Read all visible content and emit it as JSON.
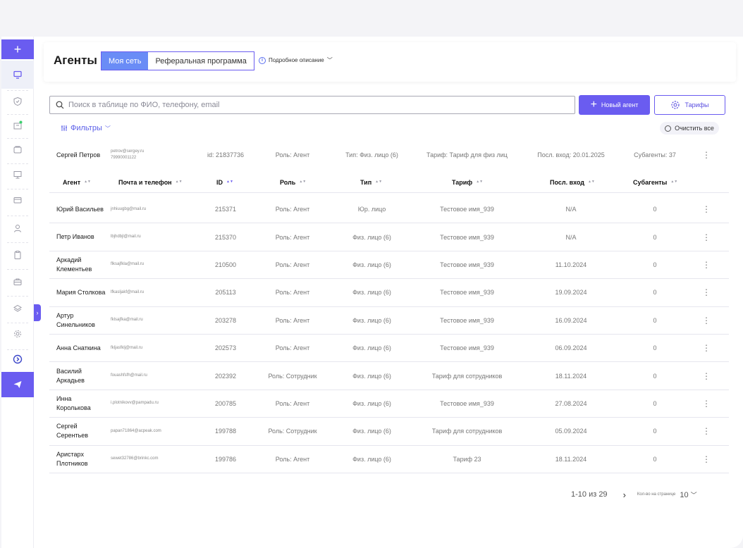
{
  "header": {
    "title": "Агенты",
    "tabs": [
      {
        "label": "Моя сеть",
        "active": true
      },
      {
        "label": "Реферальная программа",
        "active": false
      }
    ],
    "description_link": "Подробное описание"
  },
  "toolbar": {
    "search_placeholder": "Поиск в таблице по ФИО, телефону, email",
    "new_agent_label": "Новый агент",
    "tariffs_label": "Тарифы",
    "filters_label": "Фильтры",
    "clear_all_label": "Очистить все"
  },
  "summary": {
    "name": "Сергей Петров",
    "email": "petrov@sergey.ru",
    "phone": "79990001122",
    "id": "id: 21837736",
    "role": "Роль: Агент",
    "type": "Тип: Физ. лицо (6)",
    "tariff": "Тариф: Тариф для физ лиц",
    "last_login": "Посл. вход: 20.01.2025",
    "subagents": "Субагенты: 37"
  },
  "table": {
    "columns": [
      "Агент",
      "Почта и телефон",
      "ID",
      "Роль",
      "Тип",
      "Тариф",
      "Посл. вход",
      "Субагенты"
    ],
    "rows": [
      {
        "name": "Юрий Васильев",
        "email": "jnhiuugbg@mail.ru",
        "id": "215371",
        "role": "Роль: Агент",
        "type": "Юр. лицо",
        "tariff": "Тестовое имя_939",
        "last_login": "N/A",
        "subagents": "0"
      },
      {
        "name": "Петр Иванов",
        "email": "lbjhdbjl@mail.ru",
        "id": "215370",
        "role": "Роль: Агент",
        "type": "Физ. лицо (6)",
        "tariff": "Тестовое имя_939",
        "last_login": "N/A",
        "subagents": "0"
      },
      {
        "name": "Аркадий Клементьев",
        "email": "flksajfkla@mail.ru",
        "id": "210500",
        "role": "Роль: Агент",
        "type": "Физ. лицо (6)",
        "tariff": "Тестовое имя_939",
        "last_login": "11.10.2024",
        "subagents": "0"
      },
      {
        "name": "Мария Столкова",
        "email": "lfkasljakf@mail.ru",
        "id": "205113",
        "role": "Роль: Агент",
        "type": "Физ. лицо (6)",
        "tariff": "Тестовое имя_939",
        "last_login": "19.09.2024",
        "subagents": "0"
      },
      {
        "name": "Артур Синельников",
        "email": "fklsajfka@mail.ru",
        "id": "203278",
        "role": "Роль: Агент",
        "type": "Физ. лицо (6)",
        "tariff": "Тестовое имя_939",
        "last_login": "16.09.2024",
        "subagents": "0"
      },
      {
        "name": "Анна Снаткина",
        "email": "fkljasfklj@mail.ru",
        "id": "202573",
        "role": "Роль: Агент",
        "type": "Физ. лицо (6)",
        "tariff": "Тестовое имя_939",
        "last_login": "06.09.2024",
        "subagents": "0"
      },
      {
        "name": "Василий Аркадьев",
        "email": "fouashfsfh@mail.ru",
        "id": "202392",
        "role": "Роль: Сотрудник",
        "type": "Физ. лицо (6)",
        "tariff": "Тариф для сотрудников",
        "last_login": "18.11.2024",
        "subagents": "0"
      },
      {
        "name": "Инна Королькова",
        "email": "i.plotnikovv@pampadu.ru",
        "id": "200785",
        "role": "Роль: Агент",
        "type": "Физ. лицо (6)",
        "tariff": "Тестовое имя_939",
        "last_login": "27.08.2024",
        "subagents": "0"
      },
      {
        "name": "Сергей Серентьев",
        "email": "papan71864@acpeak.com",
        "id": "199788",
        "role": "Роль: Сотрудник",
        "type": "Физ. лицо (6)",
        "tariff": "Тариф для сотрудников",
        "last_login": "05.09.2024",
        "subagents": "0"
      },
      {
        "name": "Аристарх Плотников",
        "email": "sewet32786@brinkc.com",
        "id": "199786",
        "role": "Роль: Агент",
        "type": "Физ. лицо (6)",
        "tariff": "Тариф 23",
        "last_login": "18.11.2024",
        "subagents": "0"
      }
    ]
  },
  "pagination": {
    "range": "1-10 из 29",
    "per_page_label": "Кол-во на странице",
    "per_page_value": "10"
  },
  "sidebar": {
    "icons": [
      "plus-icon",
      "monitor-icon",
      "shield-icon",
      "building-icon",
      "wallet-icon",
      "screen-icon",
      "card-icon",
      "user-icon",
      "clipboard-icon",
      "briefcase-icon",
      "layers-icon",
      "gear-icon",
      "arrow-circle-icon",
      "send-icon"
    ]
  },
  "colors": {
    "accent": "#6a5cf0",
    "tab_active": "#6a8cf6"
  }
}
